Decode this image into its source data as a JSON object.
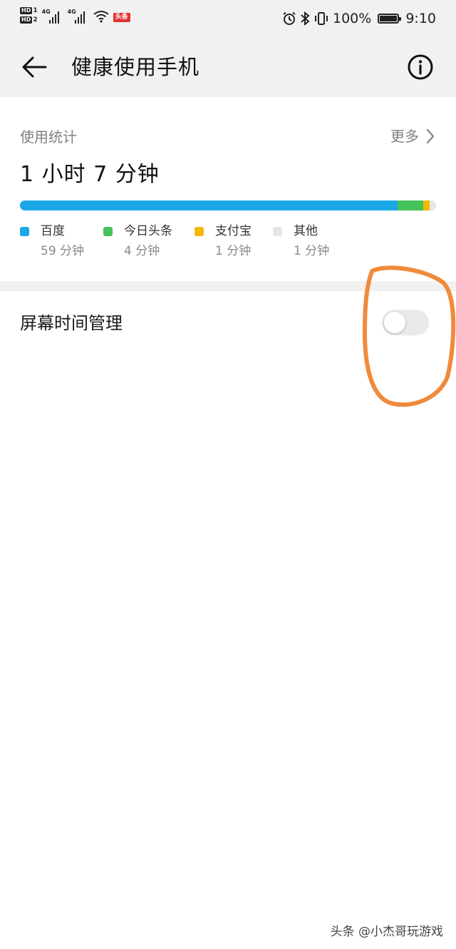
{
  "status_bar": {
    "hd1": "HD",
    "hd1_sub": "1",
    "hd2": "HD",
    "hd2_sub": "2",
    "net1": "4G",
    "net2": "4G",
    "badge": "头条",
    "battery_percent": "100%",
    "battery_level": 1.0,
    "time": "9:10",
    "icons": [
      "hd-1-icon",
      "hd-2-icon",
      "signal-1-icon",
      "signal-2-icon",
      "wifi-icon",
      "toutiao-badge-icon",
      "alarm-icon",
      "bluetooth-icon",
      "vibrate-icon",
      "battery-icon"
    ]
  },
  "header": {
    "title": "健康使用手机",
    "back_icon": "arrow-left-icon",
    "info_icon": "info-circle-icon"
  },
  "usage": {
    "section_label": "使用统计",
    "more_label": "更多",
    "more_icon": "chevron-right-icon",
    "total": "1 小时 7 分钟",
    "apps": [
      {
        "name": "百度",
        "duration": "59 分钟",
        "minutes": 59,
        "color": "#1aa7e8"
      },
      {
        "name": "今日头条",
        "duration": "4 分钟",
        "minutes": 4,
        "color": "#46c25a"
      },
      {
        "name": "支付宝",
        "duration": "1 分钟",
        "minutes": 1,
        "color": "#f5b800"
      },
      {
        "name": "其他",
        "duration": "1 分钟",
        "minutes": 1,
        "color": "#e6e6e6"
      }
    ]
  },
  "screen_time": {
    "label": "屏幕时间管理",
    "enabled": false
  },
  "annotation": {
    "color": "#f08a3c"
  },
  "watermark": "头条 @小杰哥玩游戏"
}
